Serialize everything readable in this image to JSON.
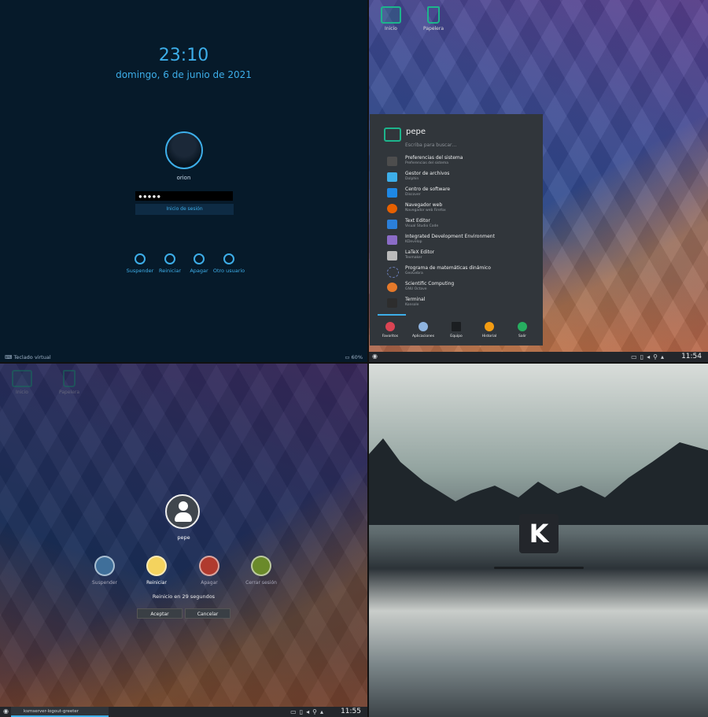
{
  "lock": {
    "time": "23:10",
    "date": "domingo, 6 de junio de 2021",
    "user": "orion",
    "password": "●●●●●",
    "login_button": "Inicio de sesión",
    "actions": [
      "Suspender",
      "Reiniciar",
      "Apagar",
      "Otro usuario"
    ],
    "virtual_keyboard": "Teclado virtual",
    "battery": "60%"
  },
  "desktop_icons": [
    "Inicio",
    "Papelera"
  ],
  "menu": {
    "user": "pepe",
    "search_placeholder": "Escriba para buscar…",
    "items": [
      {
        "name": "Preferencias del sistema",
        "desc": "Preferencias del sistema",
        "color": "#4d4d4d"
      },
      {
        "name": "Gestor de archivos",
        "desc": "Dolphin",
        "color": "#3daee9"
      },
      {
        "name": "Centro de software",
        "desc": "Discover",
        "color": "#1e88e5"
      },
      {
        "name": "Navegador web",
        "desc": "Navegador web Firefox",
        "color": "#e66000"
      },
      {
        "name": "Text Editor",
        "desc": "Visual Studio Code",
        "color": "#2b7fd9"
      },
      {
        "name": "Integrated Development Environment",
        "desc": "KDevelop",
        "color": "#8b6cc7"
      },
      {
        "name": "LaTeX Editor",
        "desc": "Texmaker",
        "color": "#bbbbbb"
      },
      {
        "name": "Programa de matemáticas dinámico",
        "desc": "GeoGebra",
        "color": "#6a7cb5"
      },
      {
        "name": "Scientific Computing",
        "desc": "GNU Octave",
        "color": "#e5792a"
      },
      {
        "name": "Terminal",
        "desc": "Konsole",
        "color": "#2d2d2d"
      }
    ],
    "tabs": [
      "Favoritos",
      "Aplicaciones",
      "Equipo",
      "Historial",
      "Salir"
    ],
    "clock": "11:54"
  },
  "logout": {
    "user": "pepe",
    "actions": [
      "Suspender",
      "Reiniciar",
      "Apagar",
      "Cerrar sesión"
    ],
    "message": "Reinicio en 29 segundos",
    "accept": "Aceptar",
    "cancel": "Cancelar",
    "task": "ksmserver-logout-greeter",
    "clock": "11:55"
  },
  "splash": {
    "logo": "K"
  }
}
